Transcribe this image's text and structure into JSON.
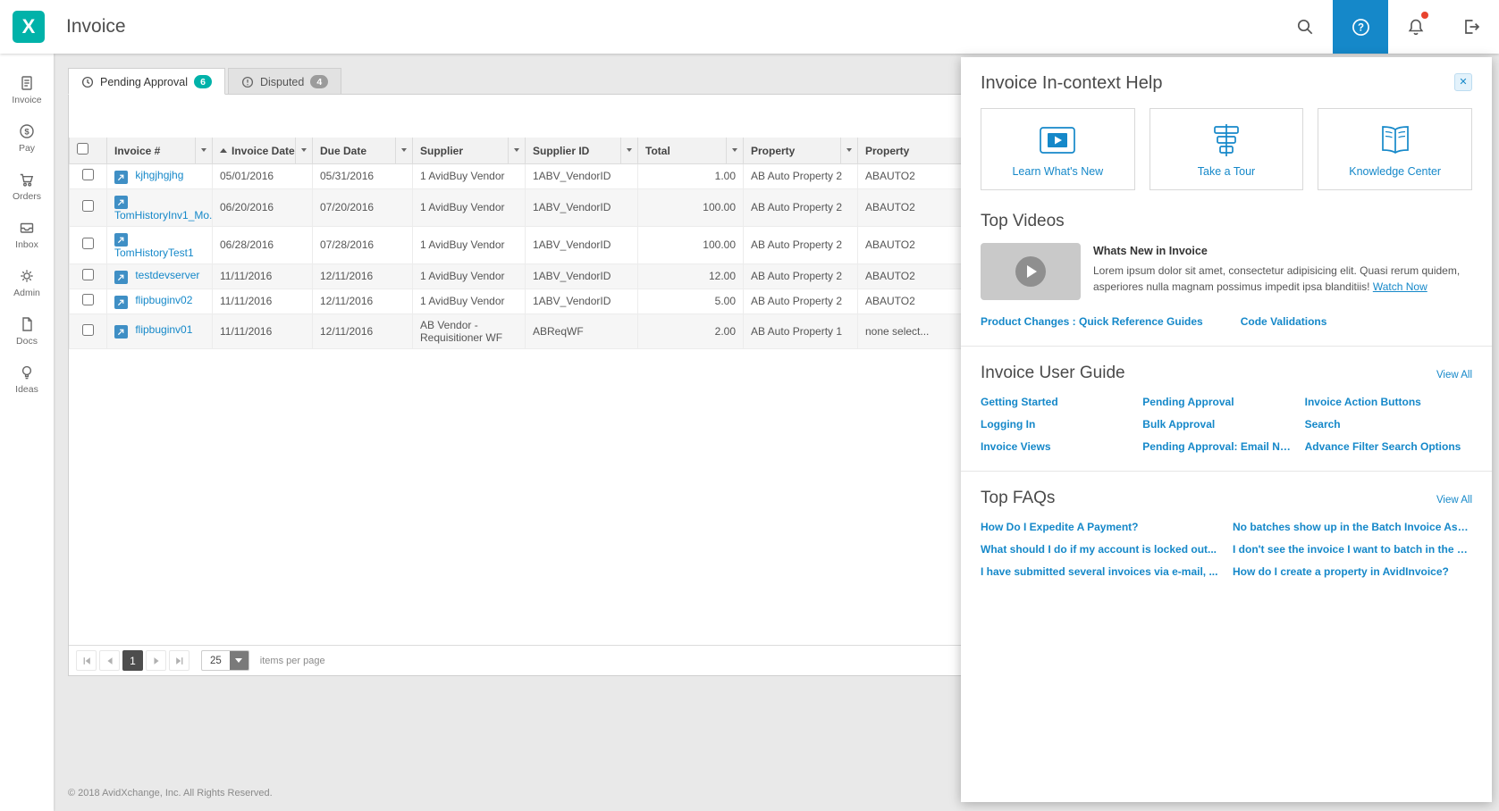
{
  "topbar": {
    "title": "Invoice",
    "logo_letter": "X",
    "icons": {
      "search": "search-icon",
      "help": "help-icon",
      "notifications": "bell-icon",
      "logout": "signout-icon"
    },
    "has_unread_notifications": true
  },
  "sidebar": {
    "items": [
      {
        "label": "Invoice",
        "icon": "invoice-icon"
      },
      {
        "label": "Pay",
        "icon": "pay-icon"
      },
      {
        "label": "Orders",
        "icon": "orders-icon"
      },
      {
        "label": "Inbox",
        "icon": "inbox-icon"
      },
      {
        "label": "Admin",
        "icon": "gear-icon"
      },
      {
        "label": "Docs",
        "icon": "docs-icon"
      },
      {
        "label": "Ideas",
        "icon": "lightbulb-icon"
      }
    ]
  },
  "tabs": [
    {
      "label": "Pending Approval",
      "badge": "6",
      "active": true,
      "icon": "clock-icon"
    },
    {
      "label": "Disputed",
      "badge": "4",
      "active": false,
      "icon": "alert-icon"
    }
  ],
  "table": {
    "columns": {
      "invoice_number": "Invoice #",
      "invoice_date": "Invoice Date",
      "due_date": "Due Date",
      "supplier": "Supplier",
      "supplier_id": "Supplier ID",
      "total": "Total",
      "property": "Property",
      "property_id": "Property"
    },
    "sorted_by": "invoice_date",
    "sort_direction": "asc",
    "rows": [
      {
        "invoice_number": "kjhgjhgjhg",
        "invoice_date": "05/01/2016",
        "due_date": "05/31/2016",
        "supplier": "1 AvidBuy Vendor",
        "supplier_id": "1ABV_VendorID",
        "total": "1.00",
        "property": "AB Auto Property 2",
        "property_id": "ABAUTO2"
      },
      {
        "invoice_number": "TomHistoryInv1_Mo...",
        "invoice_date": "06/20/2016",
        "due_date": "07/20/2016",
        "supplier": "1 AvidBuy Vendor",
        "supplier_id": "1ABV_VendorID",
        "total": "100.00",
        "property": "AB Auto Property 2",
        "property_id": "ABAUTO2"
      },
      {
        "invoice_number": "TomHistoryTest1",
        "invoice_date": "06/28/2016",
        "due_date": "07/28/2016",
        "supplier": "1 AvidBuy Vendor",
        "supplier_id": "1ABV_VendorID",
        "total": "100.00",
        "property": "AB Auto Property 2",
        "property_id": "ABAUTO2"
      },
      {
        "invoice_number": "testdevserver",
        "invoice_date": "11/11/2016",
        "due_date": "12/11/2016",
        "supplier": "1 AvidBuy Vendor",
        "supplier_id": "1ABV_VendorID",
        "total": "12.00",
        "property": "AB Auto Property 2",
        "property_id": "ABAUTO2"
      },
      {
        "invoice_number": "flipbuginv02",
        "invoice_date": "11/11/2016",
        "due_date": "12/11/2016",
        "supplier": "1 AvidBuy Vendor",
        "supplier_id": "1ABV_VendorID",
        "total": "5.00",
        "property": "AB Auto Property 2",
        "property_id": "ABAUTO2"
      },
      {
        "invoice_number": "flipbuginv01",
        "invoice_date": "11/11/2016",
        "due_date": "12/11/2016",
        "supplier": "AB Vendor - Requisitioner WF",
        "supplier_id": "ABReqWF",
        "total": "2.00",
        "property": "AB Auto Property 1",
        "property_id": "none select..."
      }
    ]
  },
  "pagination": {
    "current_page": "1",
    "page_size": "25",
    "items_per_page_label": "items per page"
  },
  "footer": {
    "copyright": "© 2018 AvidXchange, Inc. All Rights Reserved."
  },
  "help_panel": {
    "title": "Invoice In-context Help",
    "close_glyph": "✕",
    "cards": [
      {
        "label": "Learn What's New",
        "icon": "video-player-icon"
      },
      {
        "label": "Take a Tour",
        "icon": "tour-icon"
      },
      {
        "label": "Knowledge Center",
        "icon": "book-icon"
      }
    ],
    "top_videos": {
      "heading": "Top Videos",
      "video_title": "Whats New in Invoice",
      "video_description": "Lorem ipsum dolor sit amet, consectetur adipisicing elit. Quasi rerum quidem, asperiores nulla magnam possimus impedit ipsa blanditiis!",
      "watch_now": "Watch Now",
      "links": [
        "Product Changes : Quick Reference Guides",
        "Code Validations"
      ]
    },
    "user_guide": {
      "heading": "Invoice User Guide",
      "view_all": "View All",
      "links": [
        "Getting Started",
        "Pending Approval",
        "Invoice Action Buttons",
        "Logging In",
        "Bulk Approval",
        "Search",
        "Invoice Views",
        "Pending Approval: Email No...",
        "Advance Filter Search Options"
      ]
    },
    "faqs": {
      "heading": "Top FAQs",
      "view_all": "View All",
      "links": [
        "How Do I Expedite A Payment?",
        "No batches show up in the Batch Invoice Ass...",
        "What should I do if my account is locked out...",
        "I don't see the invoice I want to batch in the B...",
        "I have submitted several invoices via e-mail, ...",
        "How do I create a property in AvidInvoice?"
      ]
    }
  },
  "colors": {
    "brand_teal": "#00b2a9",
    "link_blue": "#1588c9",
    "active_help_bg": "#1588c9",
    "badge_pending": "#00b2a9",
    "badge_disputed": "#9b9b9b",
    "notification_dot": "#e8432e"
  }
}
